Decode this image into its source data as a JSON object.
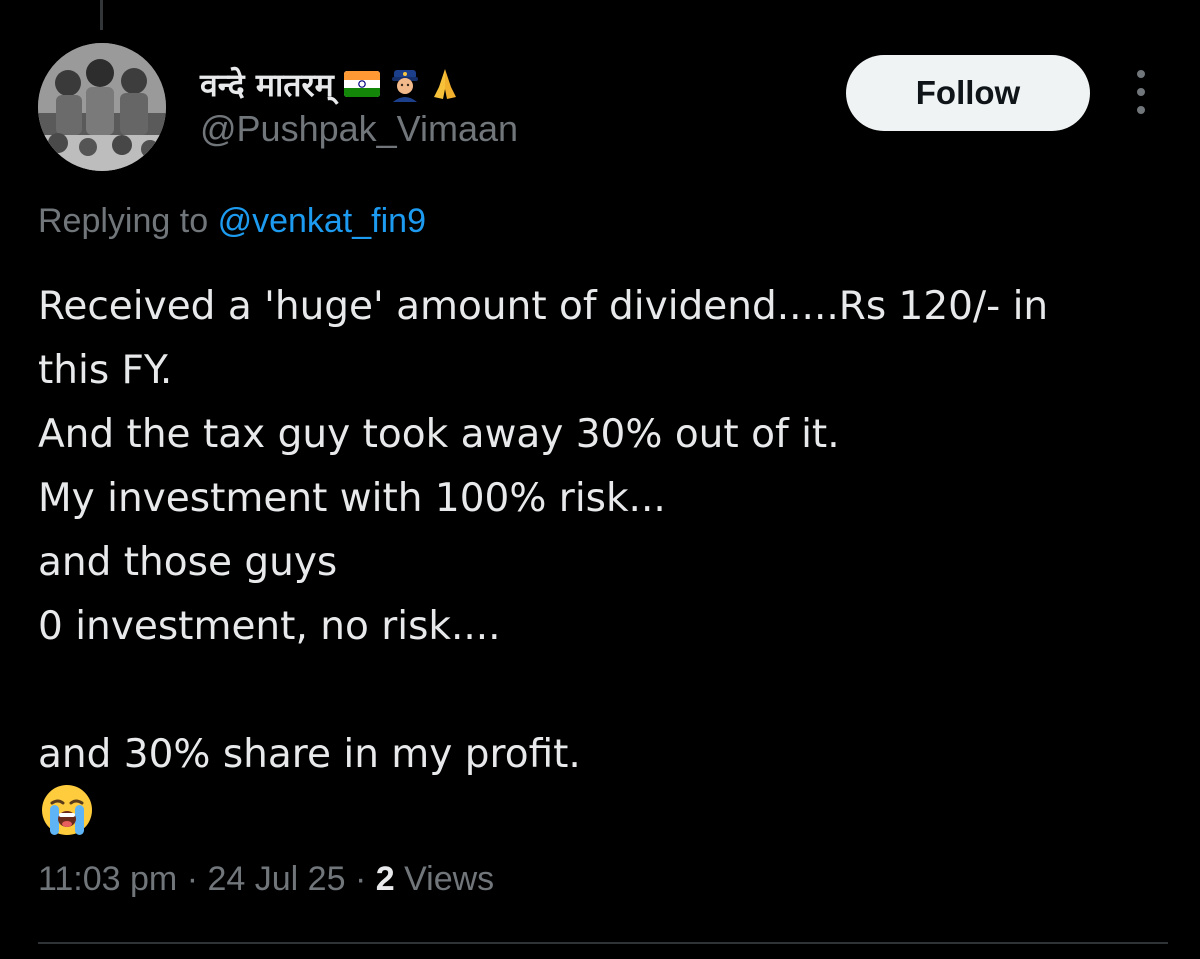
{
  "tweet": {
    "author": {
      "display_name": "वन्दे मातरम्",
      "display_emojis": [
        "indian-flag-icon",
        "police-officer-icon",
        "folded-hands-icon"
      ],
      "handle": "@Pushpak_Vimaan"
    },
    "follow_label": "Follow",
    "replying_to": {
      "prefix": "Replying to",
      "handle": "@venkat_fin9"
    },
    "text_lines": [
      "Received a 'huge' amount of dividend.....Rs 120/- in",
      "this FY.",
      "And the tax guy took away 30% out of it.",
      "My investment with 100% risk...",
      "and those guys",
      "0 investment, no risk....",
      "",
      "and 30% share in my profit."
    ],
    "trailing_emoji": "loudly-crying-face-icon",
    "time": "11:03 pm",
    "date": "24 Jul 25",
    "views_count": "2",
    "views_label": "Views"
  },
  "colors": {
    "background": "#000000",
    "primary_text": "#e7e9ea",
    "secondary_text": "#71767b",
    "link": "#1d9bf0",
    "follow_bg": "#eff3f4",
    "divider": "#2f3336"
  }
}
